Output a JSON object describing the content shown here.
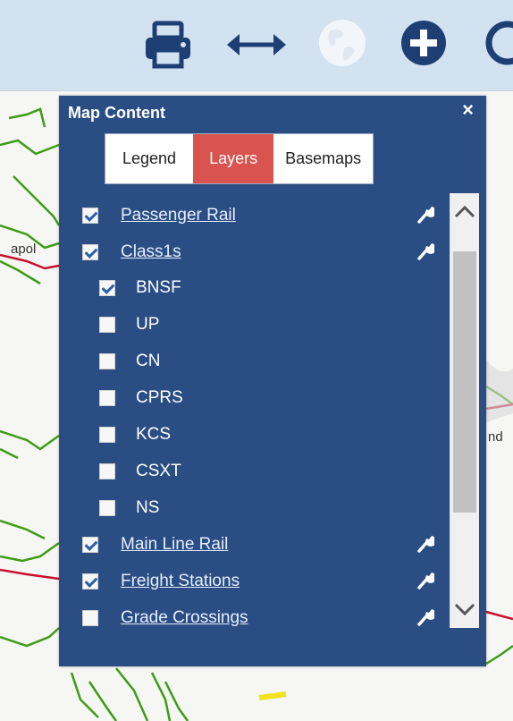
{
  "toolbar": {
    "icons": [
      "printer-icon",
      "horizontal-arrows-icon",
      "globe-icon",
      "plus-circle-icon",
      "circle-icon"
    ],
    "background": "#d2e2f1",
    "icon_color": "#1d3f73"
  },
  "map": {
    "labels": [
      "apol",
      "nd"
    ]
  },
  "panel": {
    "title": "Map Content",
    "close": "×",
    "tabs": [
      {
        "label": "Legend",
        "active": false
      },
      {
        "label": "Layers",
        "active": true
      },
      {
        "label": "Basemaps",
        "active": false
      }
    ],
    "layers": [
      {
        "label": "Passenger Rail",
        "checked": true,
        "type": "link"
      },
      {
        "label": "Class1s",
        "checked": true,
        "type": "link"
      },
      {
        "label": "BNSF",
        "checked": true,
        "type": "sub"
      },
      {
        "label": "UP",
        "checked": false,
        "type": "sub"
      },
      {
        "label": "CN",
        "checked": false,
        "type": "sub"
      },
      {
        "label": "CPRS",
        "checked": false,
        "type": "sub"
      },
      {
        "label": "KCS",
        "checked": false,
        "type": "sub"
      },
      {
        "label": "CSXT",
        "checked": false,
        "type": "sub"
      },
      {
        "label": "NS",
        "checked": false,
        "type": "sub"
      },
      {
        "label": "Main Line Rail",
        "checked": true,
        "type": "link"
      },
      {
        "label": "Freight Stations",
        "checked": true,
        "type": "link"
      },
      {
        "label": "Grade Crossings",
        "checked": false,
        "type": "link"
      }
    ],
    "colors": {
      "panel": "#2a4d84",
      "active_tab": "#d9534f"
    }
  }
}
